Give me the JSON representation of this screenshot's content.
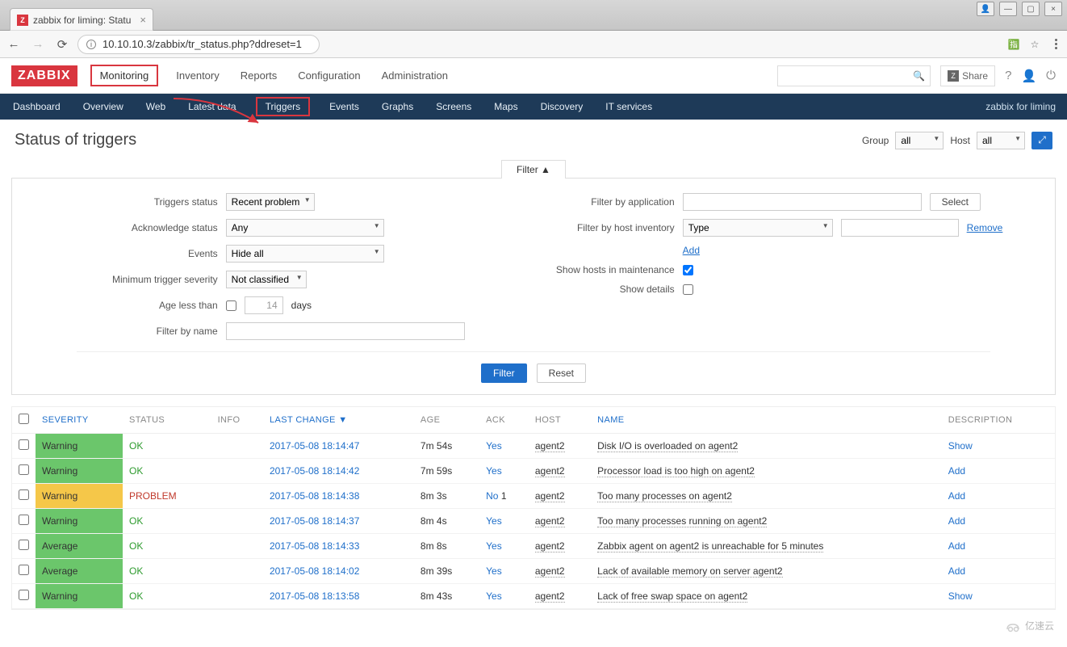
{
  "browser": {
    "tab_title": "zabbix for liming: Statu",
    "url": "10.10.10.3/zabbix/tr_status.php?ddreset=1"
  },
  "top": {
    "logo": "ZABBIX",
    "menu": [
      "Monitoring",
      "Inventory",
      "Reports",
      "Configuration",
      "Administration"
    ],
    "share": "Share",
    "help": "?"
  },
  "sub": {
    "items": [
      "Dashboard",
      "Overview",
      "Web",
      "Latest data",
      "Triggers",
      "Events",
      "Graphs",
      "Screens",
      "Maps",
      "Discovery",
      "IT services"
    ],
    "right": "zabbix for liming"
  },
  "page": {
    "title": "Status of triggers",
    "group_label": "Group",
    "group_value": "all",
    "host_label": "Host",
    "host_value": "all"
  },
  "filter": {
    "tab": "Filter ▲",
    "left": {
      "triggers_status_label": "Triggers status",
      "triggers_status_value": "Recent problem",
      "ack_status_label": "Acknowledge status",
      "ack_status_value": "Any",
      "events_label": "Events",
      "events_value": "Hide all",
      "min_sev_label": "Minimum trigger severity",
      "min_sev_value": "Not classified",
      "age_label": "Age less than",
      "age_days": "14",
      "age_unit": "days",
      "name_label": "Filter by name"
    },
    "right": {
      "app_label": "Filter by application",
      "select_btn": "Select",
      "inv_label": "Filter by host inventory",
      "inv_type": "Type",
      "remove": "Remove",
      "add": "Add",
      "maint_label": "Show hosts in maintenance",
      "details_label": "Show details"
    },
    "buttons": {
      "filter": "Filter",
      "reset": "Reset"
    }
  },
  "table": {
    "headers": {
      "severity": "SEVERITY",
      "status": "STATUS",
      "info": "INFO",
      "last_change": "LAST CHANGE ▼",
      "age": "AGE",
      "ack": "ACK",
      "host": "HOST",
      "name": "NAME",
      "description": "DESCRIPTION"
    },
    "rows": [
      {
        "severity": "Warning",
        "sev_state": "ok",
        "status": "OK",
        "last_change": "2017-05-08 18:14:47",
        "age": "7m 54s",
        "ack": "Yes",
        "host": "agent2",
        "name": "Disk I/O is overloaded on agent2",
        "desc_action": "Show"
      },
      {
        "severity": "Warning",
        "sev_state": "ok",
        "status": "OK",
        "last_change": "2017-05-08 18:14:42",
        "age": "7m 59s",
        "ack": "Yes",
        "host": "agent2",
        "name": "Processor load is too high on agent2",
        "desc_action": "Add"
      },
      {
        "severity": "Warning",
        "sev_state": "warn",
        "status": "PROBLEM",
        "last_change": "2017-05-08 18:14:38",
        "age": "8m 3s",
        "ack": "No",
        "ack_extra": "1",
        "host": "agent2",
        "name": "Too many processes on agent2",
        "desc_action": "Add"
      },
      {
        "severity": "Warning",
        "sev_state": "ok",
        "status": "OK",
        "last_change": "2017-05-08 18:14:37",
        "age": "8m 4s",
        "ack": "Yes",
        "host": "agent2",
        "name": "Too many processes running on agent2",
        "desc_action": "Add"
      },
      {
        "severity": "Average",
        "sev_state": "ok",
        "status": "OK",
        "last_change": "2017-05-08 18:14:33",
        "age": "8m 8s",
        "ack": "Yes",
        "host": "agent2",
        "name": "Zabbix agent on agent2 is unreachable for 5 minutes",
        "desc_action": "Add"
      },
      {
        "severity": "Average",
        "sev_state": "ok",
        "status": "OK",
        "last_change": "2017-05-08 18:14:02",
        "age": "8m 39s",
        "ack": "Yes",
        "host": "agent2",
        "name": "Lack of available memory on server agent2",
        "desc_action": "Add"
      },
      {
        "severity": "Warning",
        "sev_state": "ok",
        "status": "OK",
        "last_change": "2017-05-08 18:13:58",
        "age": "8m 43s",
        "ack": "Yes",
        "host": "agent2",
        "name": "Lack of free swap space on agent2",
        "desc_action": "Show"
      }
    ]
  },
  "watermark": "亿速云"
}
